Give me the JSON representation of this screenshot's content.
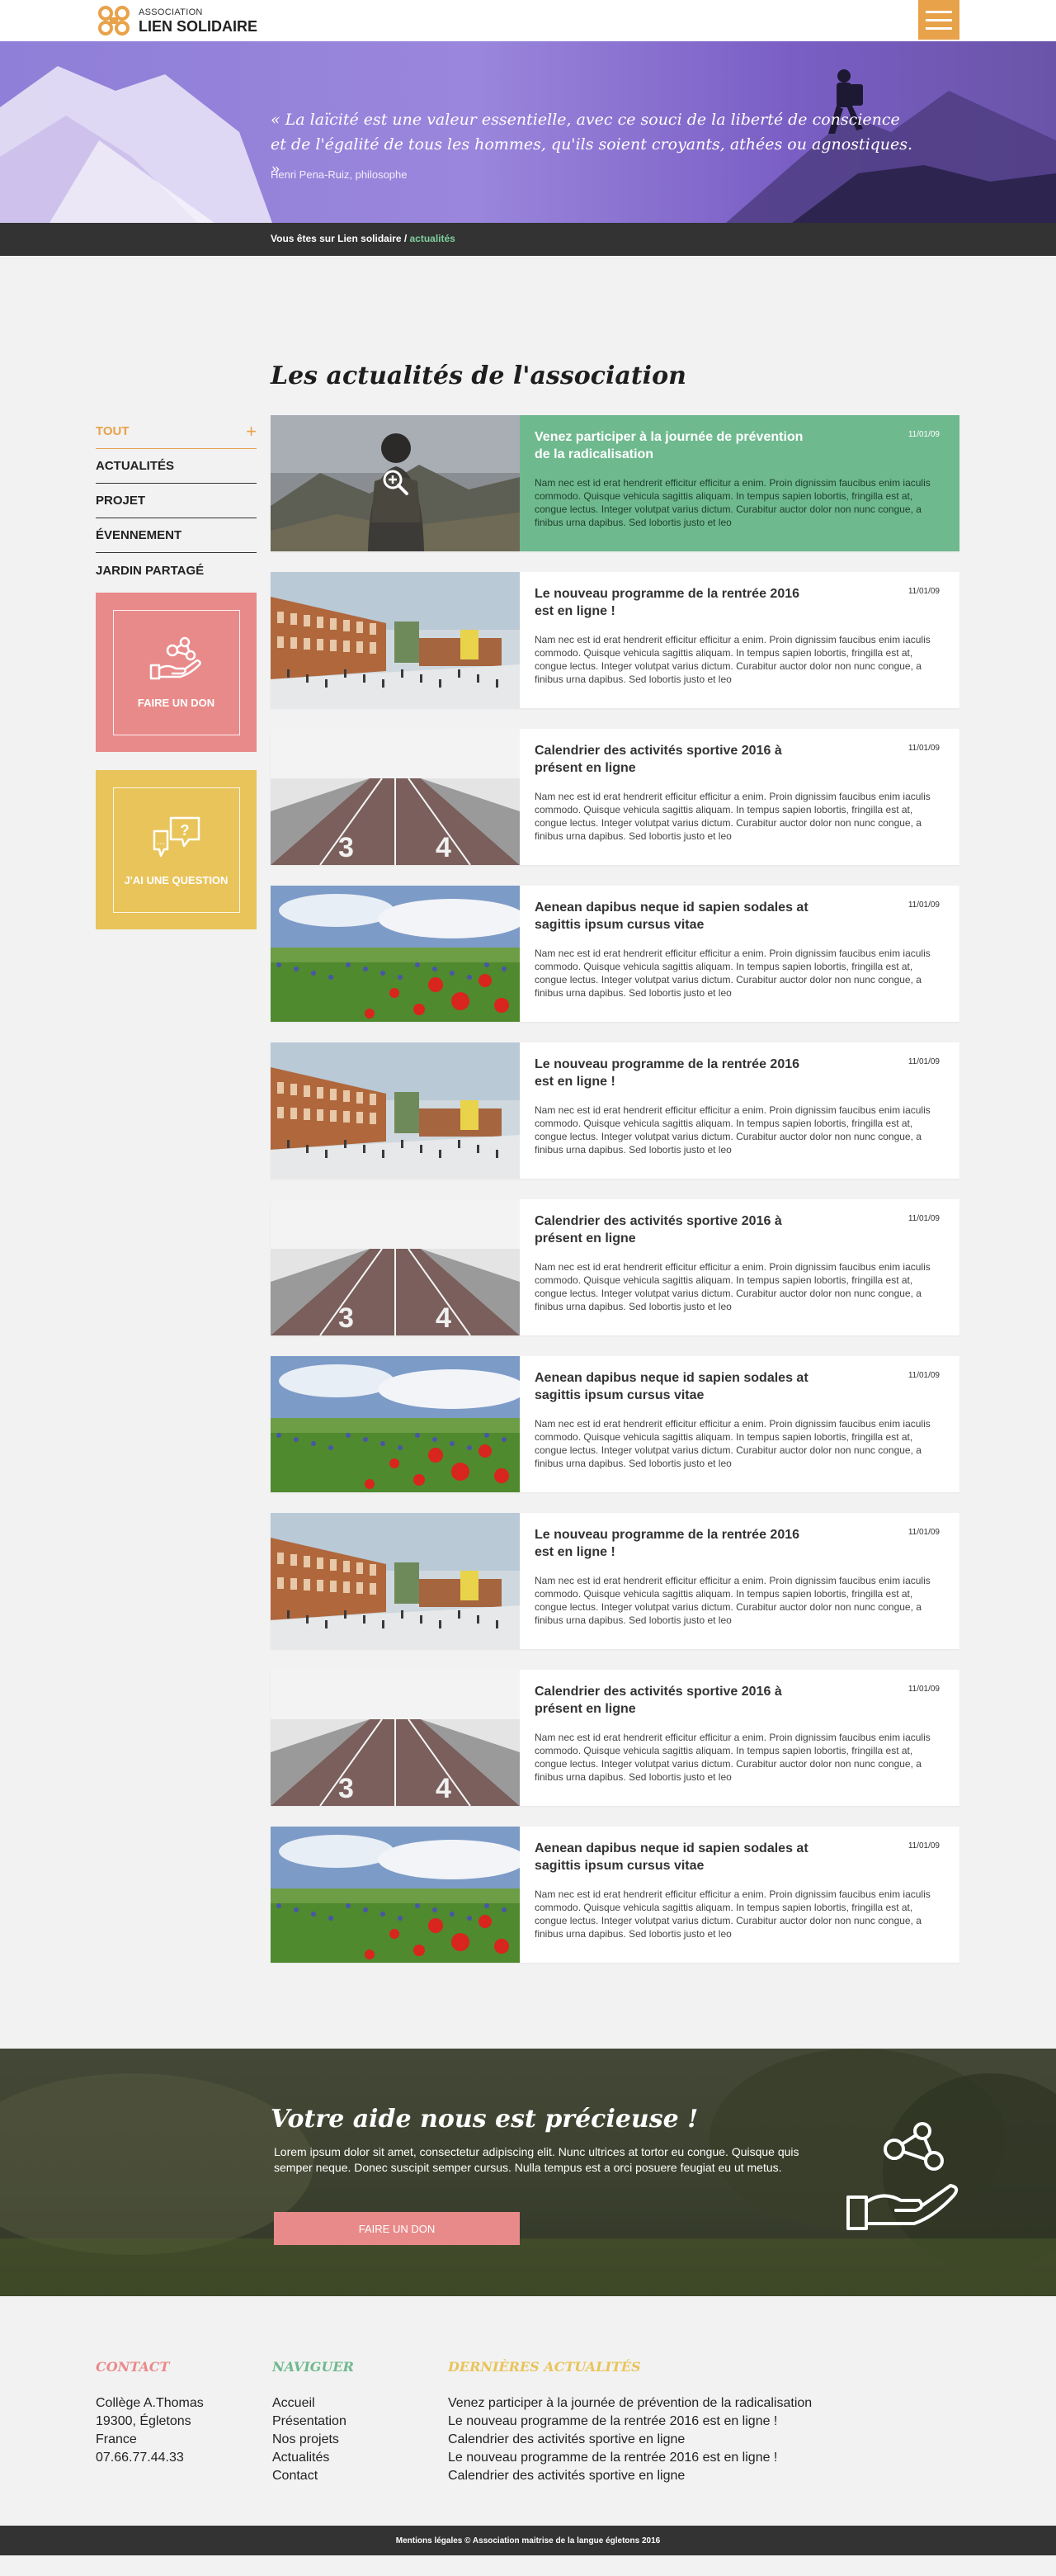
{
  "header": {
    "logo_small": "ASSOCIATION",
    "logo_big": "LIEN SOLIDAIRE",
    "colors": {
      "accent": "#e8a24a",
      "green": "#6fb98f",
      "pink": "#e98a8a",
      "yellow": "#e9c45a",
      "dark": "#333333"
    }
  },
  "hero": {
    "quote": "« La laïcité est une valeur essentielle, avec ce souci de la liberté de conscience et de l'égalité de tous les hommes, qu'ils soient croyants, athées ou agnostiques. »",
    "author": "Henri Pena-Ruiz, philosophe"
  },
  "breadcrumb": {
    "prefix": "Vous êtes sur Lien solidaire / ",
    "current": "actualités"
  },
  "page_title": "Les actualités de l'association",
  "filters": [
    {
      "label": "TOUT",
      "active": true,
      "icon": "plus-icon"
    },
    {
      "label": "ACTUALITÉS"
    },
    {
      "label": "PROJET"
    },
    {
      "label": "ÉVENNEMENT"
    },
    {
      "label": "JARDIN PARTAGÉ"
    }
  ],
  "ctas": {
    "donate": "FAIRE UN DON",
    "question": "J'AI UNE QUESTION"
  },
  "lorem": "Nam nec est id erat hendrerit efficitur efficitur a enim. Proin dignissim faucibus enim iaculis commodo. Quisque vehicula sagittis aliquam. In tempus sapien lobortis, fringilla est at, congue lectus. Integer volutpat varius dictum. Curabitur auctor dolor non nunc congue, a finibus urna dapibus. Sed lobortis justo et leo",
  "articles": [
    {
      "title": "Venez participer à la journée de prévention de la radicalisation",
      "date": "11/01/09",
      "image": "person-mountain",
      "featured": true
    },
    {
      "title": "Le nouveau programme de la rentrée 2016 est en ligne !",
      "date": "11/01/09",
      "image": "school"
    },
    {
      "title": "Calendrier des activités sportive 2016 à présent en ligne",
      "date": "11/01/09",
      "image": "track"
    },
    {
      "title": "Aenean dapibus neque id sapien sodales at sagittis ipsum cursus vitae",
      "date": "11/01/09",
      "image": "poppies"
    },
    {
      "title": "Le nouveau programme de la rentrée 2016 est en ligne !",
      "date": "11/01/09",
      "image": "school"
    },
    {
      "title": "Calendrier des activités sportive 2016 à présent en ligne",
      "date": "11/01/09",
      "image": "track"
    },
    {
      "title": "Aenean dapibus neque id sapien sodales at sagittis ipsum cursus vitae",
      "date": "11/01/09",
      "image": "poppies"
    },
    {
      "title": "Le nouveau programme de la rentrée 2016 est en ligne !",
      "date": "11/01/09",
      "image": "school"
    },
    {
      "title": "Calendrier des activités sportive 2016 à présent en ligne",
      "date": "11/01/09",
      "image": "track"
    },
    {
      "title": "Aenean dapibus neque id sapien sodales at sagittis ipsum cursus vitae",
      "date": "11/01/09",
      "image": "poppies"
    }
  ],
  "donate_band": {
    "title": "Votre aide nous est précieuse !",
    "text": "Lorem ipsum dolor sit amet, consectetur adipiscing elit. Nunc ultrices at tortor eu congue. Quisque quis semper neque. Donec suscipit semper cursus. Nulla tempus est a orci posuere feugiat eu ut metus.",
    "button": "FAIRE UN DON"
  },
  "footer": {
    "contact": {
      "title": "CONTACT",
      "lines": [
        "Collège A.Thomas",
        "19300, Égletons",
        "France",
        "07.66.77.44.33"
      ]
    },
    "nav": {
      "title": "NAVIGUER",
      "links": [
        "Accueil",
        "Présentation",
        "Nos projets",
        "Actualités",
        "Contact"
      ]
    },
    "news": {
      "title": "DERNIÈRES ACTUALITÉS",
      "links": [
        "Venez participer à la journée de prévention de la radicalisation",
        "Le nouveau programme de la rentrée 2016 est en ligne !",
        "Calendrier des activités sportive en ligne",
        "Le nouveau programme de la rentrée 2016 est en ligne !",
        "Calendrier des activités sportive en ligne"
      ]
    },
    "copyright": "Mentions légales © Association maitrise de la langue égletons 2016"
  }
}
